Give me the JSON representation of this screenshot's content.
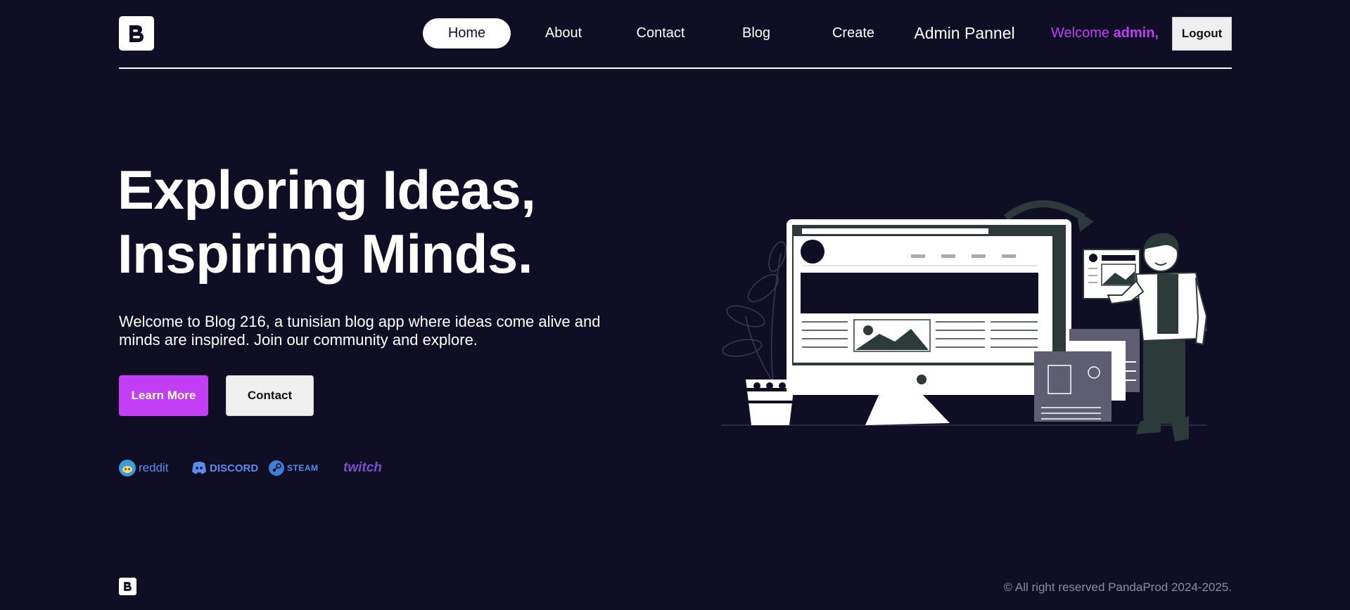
{
  "brand": {
    "logo_icon": "blogger-b-icon"
  },
  "nav": {
    "items": [
      {
        "label": "Home",
        "active": true
      },
      {
        "label": "About",
        "active": false
      },
      {
        "label": "Contact",
        "active": false
      },
      {
        "label": "Blog",
        "active": false
      },
      {
        "label": "Create",
        "active": false
      },
      {
        "label": "Admin Pannel",
        "active": false
      }
    ],
    "welcome_prefix": "Welcome",
    "welcome_user": "admin,",
    "logout_label": "Logout"
  },
  "hero": {
    "title_line1": "Exploring Ideas,",
    "title_line2": "Inspiring Minds.",
    "text": "Welcome to Blog 216, a tunisian blog app where ideas come alive and minds are inspired. Join our community and explore.",
    "learn_more_label": "Learn More",
    "contact_label": "Contact"
  },
  "partners": {
    "reddit": "reddit",
    "discord": "DISCORD",
    "steam": "STEAM",
    "twitch": "twitch"
  },
  "footer": {
    "copyright": "© All right reserved PandaProd 2024-2025."
  },
  "colors": {
    "background": "#0f0e24",
    "accent": "#c13ef5",
    "text": "#ffffff",
    "muted": "#8d8d9b"
  }
}
